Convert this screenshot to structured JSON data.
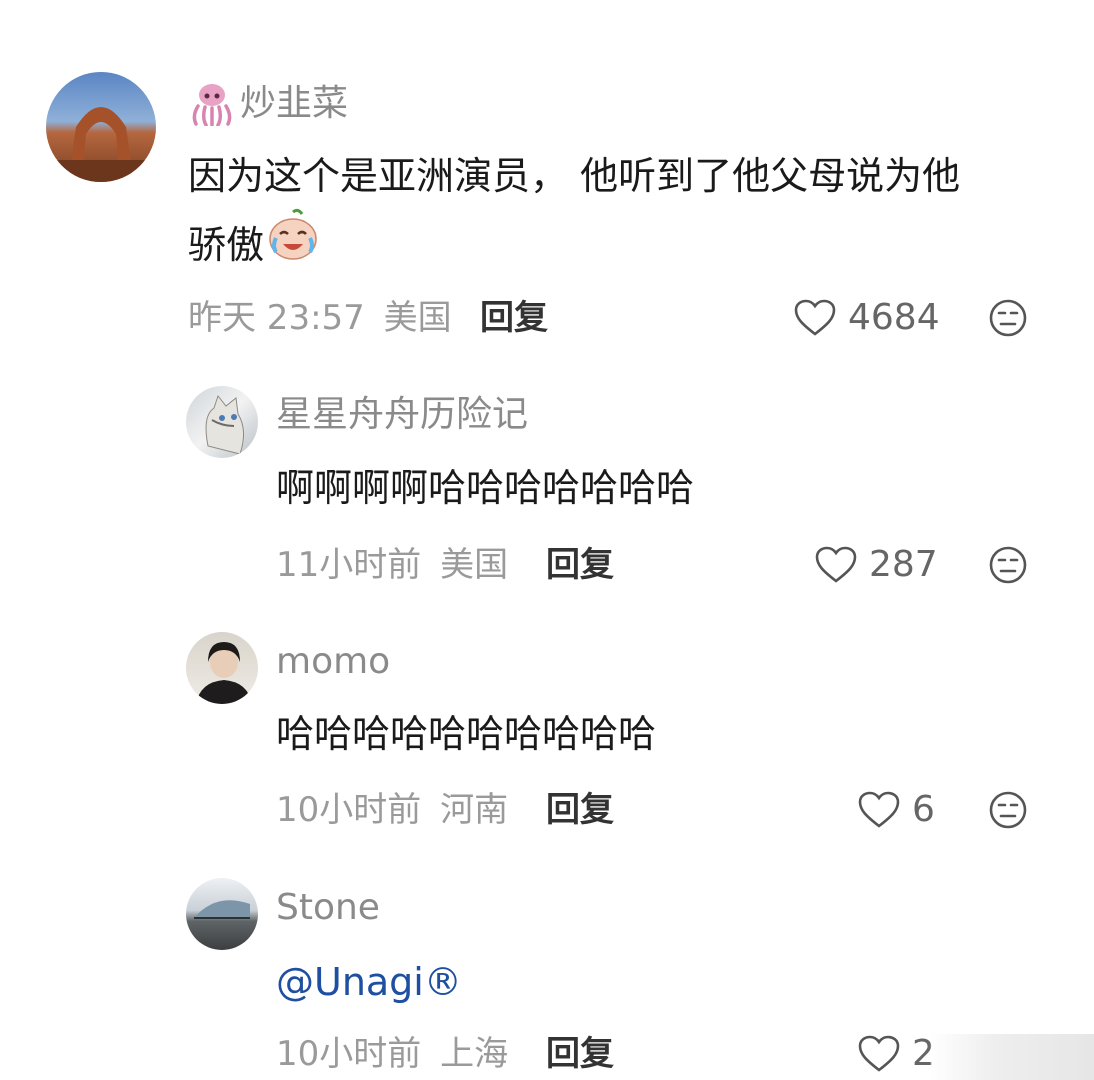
{
  "comments": [
    {
      "username": "炒韭菜",
      "username_prefix_icon": "squid-emoji-icon",
      "text_line1": "因为这个是亚洲演员， 他听到了他父母说为他",
      "text_line2": "骄傲",
      "text_emoji": "crying-laughing-emoji-icon",
      "time": "昨天 23:57",
      "location": "美国",
      "reply_label": "回复",
      "likes": "4684"
    },
    {
      "username": "星星舟舟历险记",
      "text": "啊啊啊啊哈哈哈哈哈哈哈",
      "time": "11小时前",
      "location": "美国",
      "reply_label": "回复",
      "likes": "287"
    },
    {
      "username": "momo",
      "text": "哈哈哈哈哈哈哈哈哈哈",
      "time": "10小时前",
      "location": "河南",
      "reply_label": "回复",
      "likes": "6"
    },
    {
      "username": "Stone",
      "mention": "@Unagi®",
      "time": "10小时前",
      "location": "上海",
      "reply_label": "回复",
      "likes": "2"
    }
  ],
  "colors": {
    "mention": "#1f4fa0",
    "meta": "#9a9a9a",
    "username": "#8a8a8a"
  }
}
